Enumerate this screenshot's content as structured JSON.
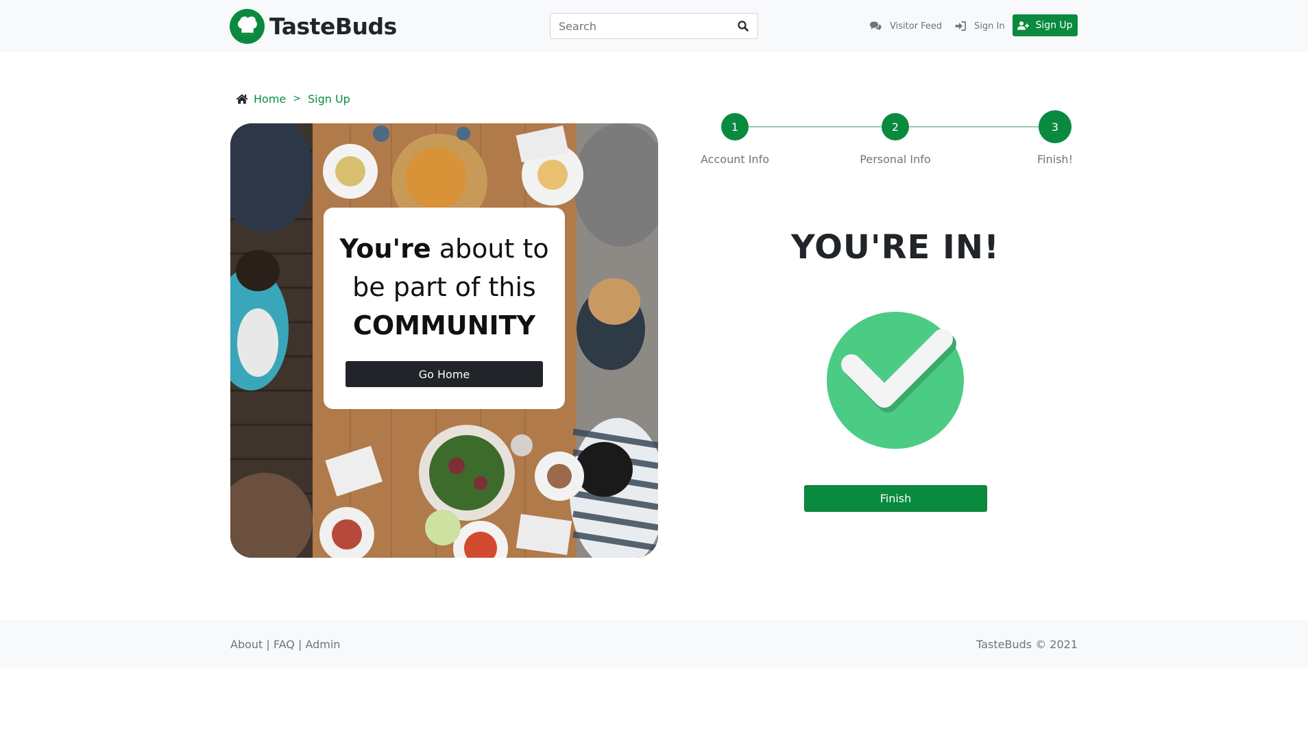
{
  "header": {
    "brand_name": "TasteBuds",
    "logo_icon": "chef-hat-icon",
    "search_placeholder": "Search",
    "nav": {
      "visitor_feed": "Visitor Feed",
      "sign_in": "Sign In",
      "sign_up": "Sign Up"
    }
  },
  "breadcrumb": {
    "items": [
      "Home",
      "Sign Up"
    ],
    "separator": ">"
  },
  "hero": {
    "line1_bold": "You're",
    "line1_rest": " about to",
    "line2": "be part of this",
    "line3": "COMMUNITY",
    "button": "Go Home"
  },
  "stepper": {
    "steps": [
      {
        "number": "1",
        "label": "Account Info"
      },
      {
        "number": "2",
        "label": "Personal Info"
      },
      {
        "number": "3",
        "label": "Finish!"
      }
    ],
    "current_step": 3
  },
  "success": {
    "title": "YOU'RE IN!",
    "icon": "check-circle-icon",
    "button": "Finish"
  },
  "footer": {
    "links": [
      "About",
      "FAQ",
      "Admin"
    ],
    "copyright": "TasteBuds © 2021"
  },
  "colors": {
    "brand_green": "#0a8a3e",
    "check_green": "#4ccb84",
    "dark": "#212529"
  }
}
